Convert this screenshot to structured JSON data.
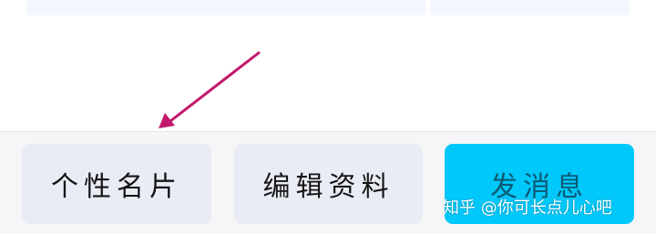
{
  "profile_actions": {
    "card_label": "个性名片",
    "edit_label": "编辑资料",
    "message_label": "发消息"
  },
  "watermark": {
    "text": "知乎 @你可长点儿心吧"
  },
  "colors": {
    "button_bg": "#e9ebf5",
    "message_bg": "#00c8fb",
    "arrow": "#c2186b",
    "bar_bg": "#f6f6f8"
  }
}
